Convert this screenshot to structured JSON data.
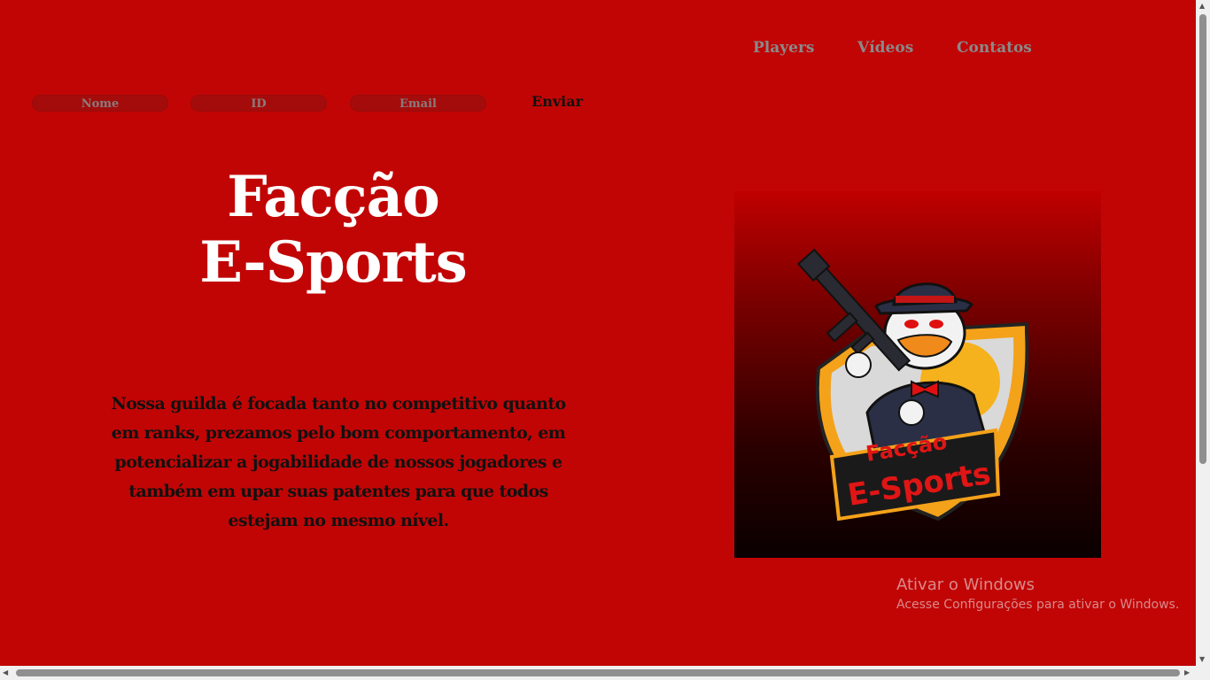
{
  "nav": {
    "items": [
      {
        "label": "Players"
      },
      {
        "label": "Vídeos"
      },
      {
        "label": "Contatos"
      }
    ]
  },
  "form": {
    "name_placeholder": "Nome",
    "id_placeholder": "ID",
    "email_placeholder": "Email",
    "submit_label": "Enviar"
  },
  "hero": {
    "title_line1": "Facção",
    "title_line2": "E-Sports",
    "description": "Nossa guilda é focada tanto no competitivo quanto em ranks, prezamos pelo bom comportamento, em potencializar a jogabilidade de nossos jogadores e também em upar suas patentes para que todos estejam no mesmo nível."
  },
  "logo": {
    "text_line1": "Facção",
    "text_line2": "E-Sports"
  },
  "watermark": {
    "line1": "Ativar o Windows",
    "line2": "Acesse Configurações para ativar o Windows."
  },
  "colors": {
    "background": "#c10505",
    "title": "#ffffff",
    "nav_text": "#8a8a8a"
  }
}
